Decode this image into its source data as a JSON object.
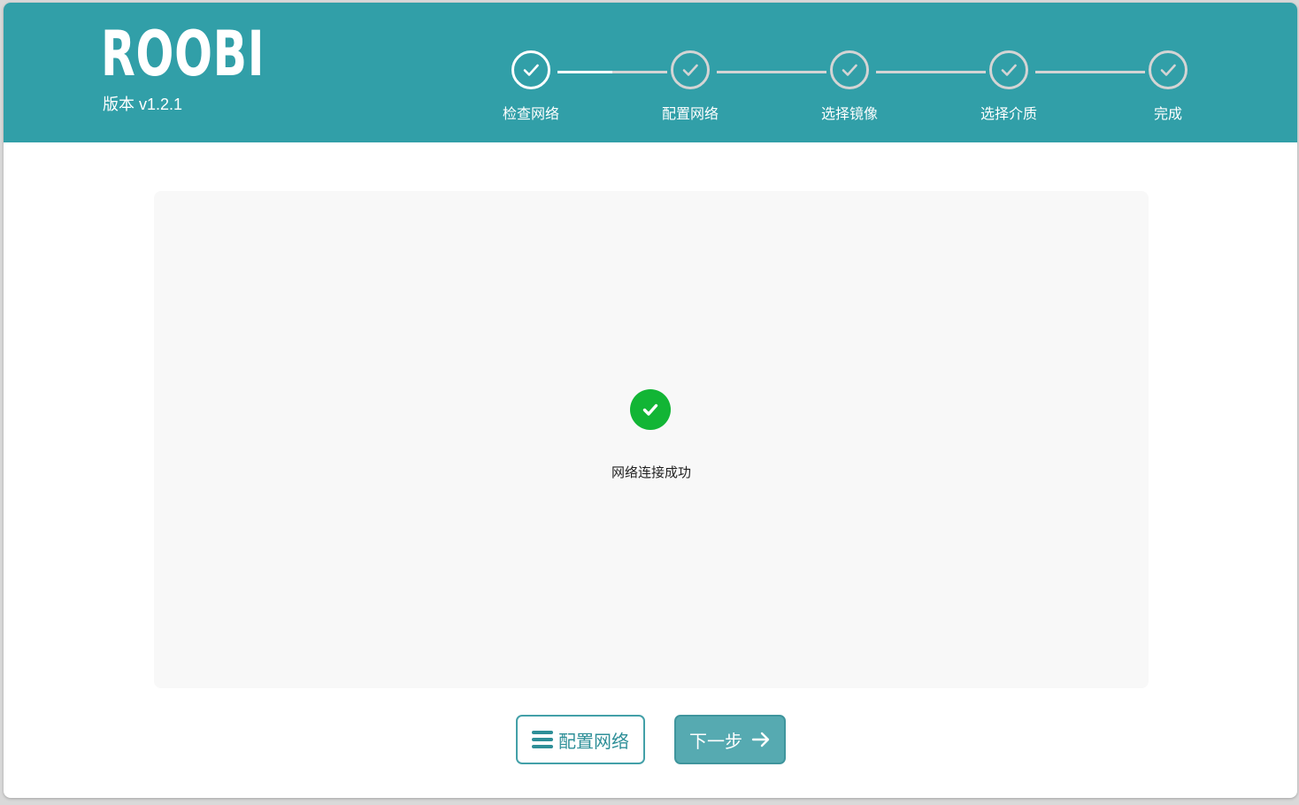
{
  "header": {
    "logo": "ROOBI",
    "version": "版本 v1.2.1"
  },
  "steps": [
    {
      "label": "检查网络",
      "status": "completed",
      "icon": "check-icon"
    },
    {
      "label": "配置网络",
      "status": "completed",
      "icon": "check-icon"
    },
    {
      "label": "选择镜像",
      "status": "completed",
      "icon": "check-icon"
    },
    {
      "label": "选择介质",
      "status": "completed",
      "icon": "check-icon"
    },
    {
      "label": "完成",
      "status": "completed",
      "icon": "check-icon"
    }
  ],
  "stepper": {
    "current_step": 1,
    "first_segment_progress": 0.5
  },
  "main": {
    "status_icon": "success-check-icon",
    "status_text": "网络连接成功"
  },
  "buttons": {
    "config_label": "配置网络",
    "config_icon": "menu-icon",
    "next_label": "下一步",
    "next_icon": "arrow-right-icon"
  },
  "colors": {
    "header_bg": "#319fa8",
    "success": "#12b535",
    "accent": "#43a0a8",
    "next_button_bg": "#56aab1"
  }
}
